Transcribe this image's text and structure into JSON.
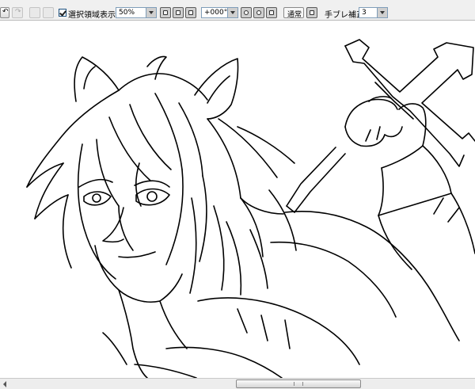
{
  "toolbar": {
    "selection_display_checked": true,
    "selection_display_label": "選択領域表示",
    "zoom_value": "50%",
    "rotation_value": "+000°",
    "blend_mode_label": "通常",
    "stabilizer_label": "手ブレ補正",
    "stabilizer_value": "3"
  },
  "canvas": {
    "content": "line-art-illustration",
    "icon": "line-drawing"
  },
  "icons": {
    "undo": "undo-icon",
    "redo": "redo-icon",
    "zoom_out": "zoom-out-icon",
    "zoom_in": "zoom-in-icon",
    "rotate_left": "rotate-left-icon",
    "rotate_right": "rotate-right-icon",
    "reset_view": "reset-icon"
  },
  "colors": {
    "toolbar_bg": "#f0f0f0",
    "canvas_bg": "#ffffff",
    "line_color": "#000000"
  }
}
